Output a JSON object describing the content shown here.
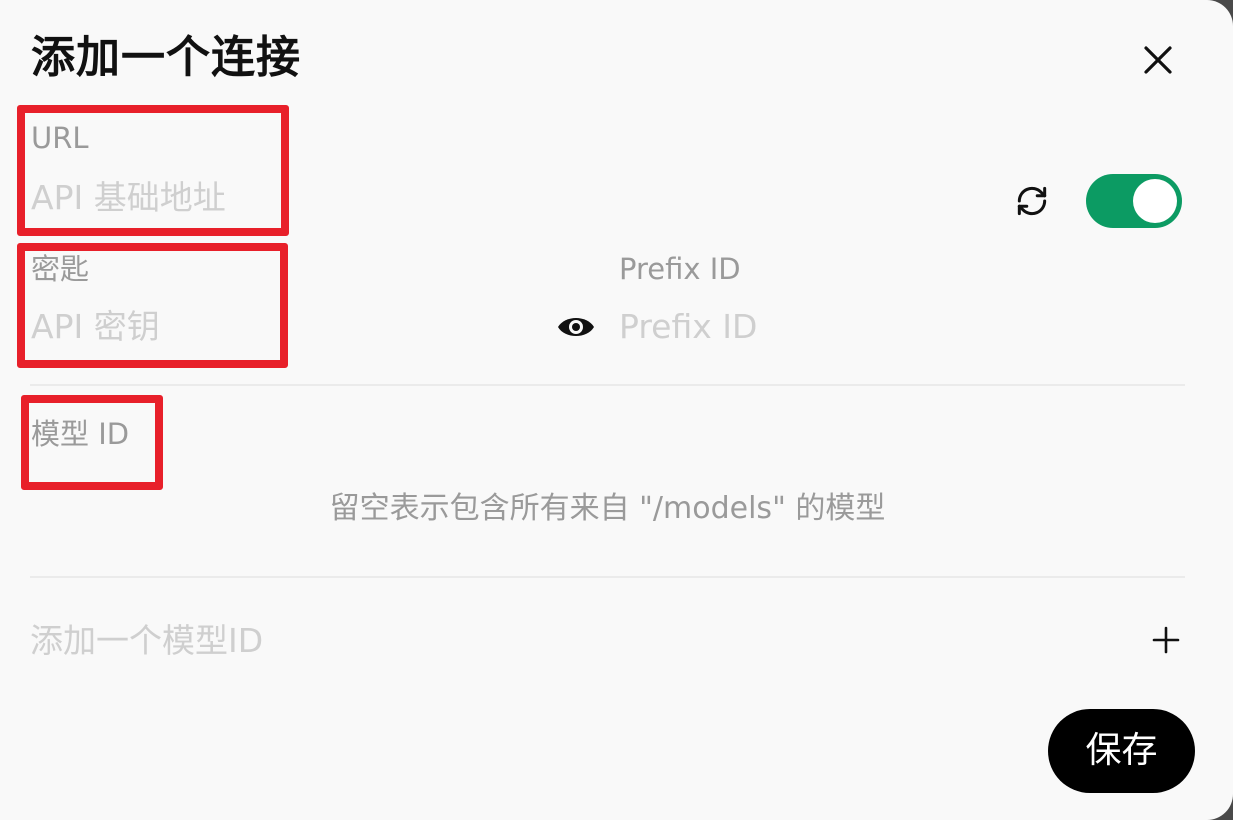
{
  "dialog": {
    "title": "添加一个连接",
    "close_icon": "close-icon"
  },
  "url_field": {
    "label": "URL",
    "placeholder": "API 基础地址",
    "value": ""
  },
  "connection": {
    "refresh_icon": "refresh-icon",
    "enabled": true,
    "toggle_color": "#0c9b63"
  },
  "key_field": {
    "label": "密匙",
    "placeholder": "API 密钥",
    "value": "",
    "visibility_icon": "eye-icon"
  },
  "prefix_field": {
    "label": "Prefix ID",
    "placeholder": "Prefix ID",
    "value": ""
  },
  "model_ids": {
    "label": "模型 ID",
    "empty_hint": "留空表示包含所有来自 \"/models\" 的模型",
    "add_placeholder": "添加一个模型ID",
    "add_icon": "plus-icon"
  },
  "footer": {
    "save_label": "保存"
  },
  "annotation_color": "#e8202a"
}
